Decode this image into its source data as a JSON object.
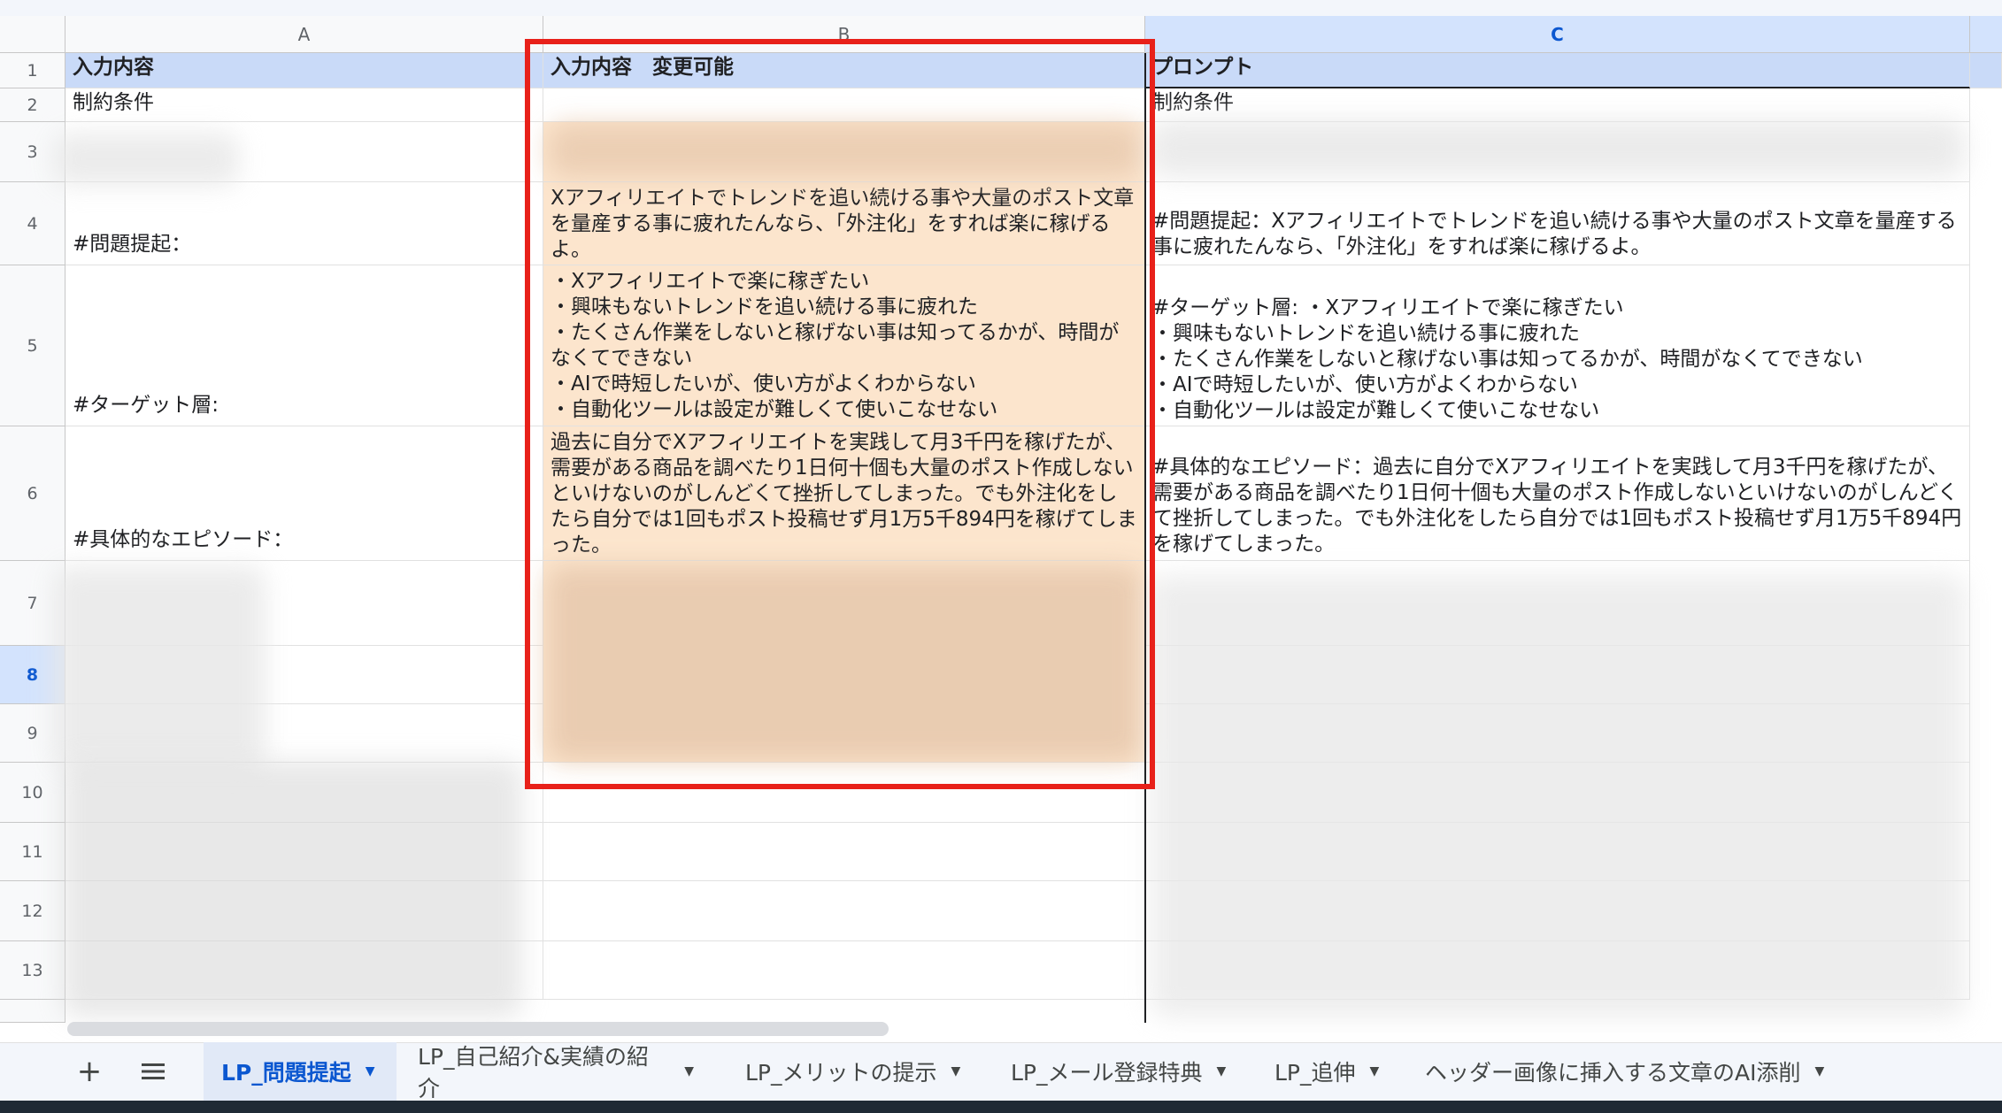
{
  "columns": {
    "a": "A",
    "b": "B",
    "c": "C"
  },
  "rows": [
    "1",
    "2",
    "3",
    "4",
    "5",
    "6",
    "7",
    "8",
    "9",
    "10",
    "11",
    "12",
    "13"
  ],
  "selected_row": "8",
  "cells": {
    "a1": "入力内容",
    "b1": "入力内容　変更可能",
    "c1": "プロンプト",
    "a2": "制約条件",
    "c2": "制約条件",
    "a4": "#問題提起：",
    "b4": "Xアフィリエイトでトレンドを追い続ける事や大量のポスト文章を量産する事に疲れたんなら、「外注化」をすれば楽に稼げるよ。",
    "c4": "#問題提起：Xアフィリエイトでトレンドを追い続ける事や大量のポスト文章を量産する事に疲れたんなら、「外注化」をすれば楽に稼げるよ。",
    "a5": "#ターゲット層:",
    "b5": "・Xアフィリエイトで楽に稼ぎたい\n・興味もないトレンドを追い続ける事に疲れた\n・たくさん作業をしないと稼げない事は知ってるかが、時間がなくてできない\n・AIで時短したいが、使い方がよくわからない\n・自動化ツールは設定が難しくて使いこなせない",
    "c5": "#ターゲット層: ・Xアフィリエイトで楽に稼ぎたい\n・興味もないトレンドを追い続ける事に疲れた\n・たくさん作業をしないと稼げない事は知ってるかが、時間がなくてできない\n・AIで時短したいが、使い方がよくわからない\n・自動化ツールは設定が難しくて使いこなせない",
    "a6": "#具体的なエピソード：",
    "b6": "過去に自分でXアフィリエイトを実践して月3千円を稼げたが、需要がある商品を調べたり1日何十個も大量のポスト作成しないといけないのがしんどくて挫折してしまった。でも外注化をしたら自分では1回もポスト投稿せず月1万5千894円を稼げてしまった。",
    "c6": "#具体的なエピソード：過去に自分でXアフィリエイトを実践して月3千円を稼げたが、需要がある商品を調べたり1日何十個も大量のポスト作成しないといけないのがしんどくて挫折してしまった。でも外注化をしたら自分では1回もポスト投稿せず月1万5千894円を稼げてしまった。"
  },
  "sheet_tabs": [
    "LP_問題提起",
    "LP_自己紹介&実績の紹介",
    "LP_メリットの提示",
    "LP_メール登録特典",
    "LP_追伸",
    "ヘッダー画像に挿入する文章のAI添削"
  ],
  "active_tab": "LP_問題提起",
  "icons": {
    "add": "plus-icon",
    "menu": "hamburger-icon",
    "caret": "caret-down-icon"
  },
  "colors": {
    "highlight": "#e8211a",
    "header_fill": "#c9daf8",
    "orange_fill": "#fce5cd",
    "active_tab": "#0b57d0"
  }
}
